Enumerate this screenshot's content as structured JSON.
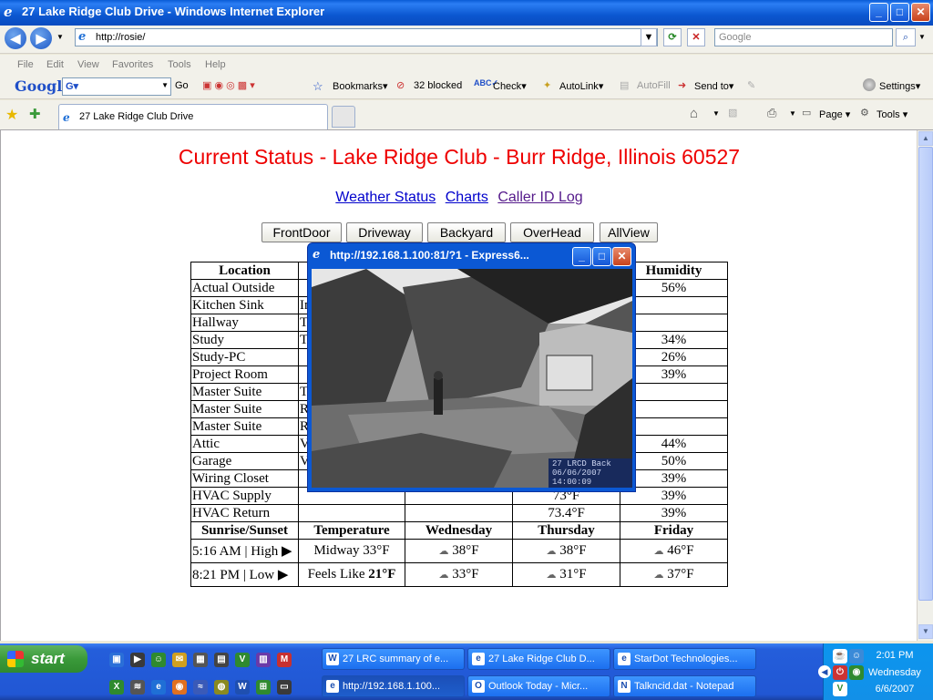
{
  "window": {
    "title": "27 Lake Ridge Club Drive - Windows Internet Explorer",
    "controls": {
      "minimize": "_",
      "maximize": "□",
      "close": "✕"
    }
  },
  "address": {
    "url": "http://rosie/",
    "search_placeholder": "Google"
  },
  "menu": [
    "File",
    "Edit",
    "View",
    "Favorites",
    "Tools",
    "Help"
  ],
  "google_toolbar": {
    "logo": "Google",
    "go": "Go",
    "bookmarks": "Bookmarks",
    "blocked": "32 blocked",
    "check": "Check",
    "autolink": "AutoLink",
    "autofill": "AutoFill",
    "sendto": "Send to",
    "settings": "Settings"
  },
  "tabs": {
    "active_label": "27 Lake Ridge Club Drive",
    "page": "Page",
    "tools": "Tools"
  },
  "page": {
    "title": "Current Status - Lake Ridge Club - Burr Ridge, Illinois 60527",
    "links": [
      "Weather Status",
      "Charts",
      "Caller ID Log"
    ],
    "camera_buttons": [
      "FrontDoor",
      "Driveway",
      "Backyard",
      "OverHead",
      "AllView"
    ],
    "table": {
      "header": {
        "location": "Location",
        "humidity": "Humidity"
      },
      "rows": [
        {
          "loc": "Actual Outside",
          "c2": "",
          "c4": "",
          "hum": "56%"
        },
        {
          "loc": "Kitchen Sink",
          "c2": "In",
          "c4": "",
          "hum": ""
        },
        {
          "loc": "Hallway",
          "c2": "T",
          "c4": "",
          "hum": ""
        },
        {
          "loc": "Study",
          "c2": "T",
          "c4": "",
          "hum": "34%"
        },
        {
          "loc": "Study-PC",
          "c2": "",
          "c4": "",
          "hum": "26%"
        },
        {
          "loc": "Project Room",
          "c2": "",
          "c4": "",
          "hum": "39%"
        },
        {
          "loc": "Master Suite",
          "c2": "T",
          "c4": "",
          "hum": ""
        },
        {
          "loc": "Master Suite",
          "c2": "R",
          "c4": "",
          "hum": ""
        },
        {
          "loc": "Master Suite",
          "c2": "R",
          "c4": "",
          "hum": ""
        },
        {
          "loc": "Attic",
          "c2": "V",
          "c4": "",
          "hum": "44%"
        },
        {
          "loc": "Garage",
          "c2": "V",
          "c4": "",
          "hum": "50%"
        },
        {
          "loc": "Wiring Closet",
          "c2": "",
          "c4": "74.2°F",
          "hum": "39%"
        },
        {
          "loc": "HVAC Supply",
          "c2": "",
          "c4": "73°F",
          "hum": "39%"
        },
        {
          "loc": "HVAC Return",
          "c2": "",
          "c4": "73.4°F",
          "hum": "39%"
        }
      ],
      "forecast_header": [
        "Sunrise/Sunset",
        "Temperature",
        "Wednesday",
        "Thursday",
        "Friday"
      ],
      "forecast_rows": [
        {
          "sun": "5:16 AM | High ▶",
          "temp_prefix": "Midway 33°F",
          "temp_bold": "",
          "wed": "38°F",
          "thu": "38°F",
          "fri": "46°F"
        },
        {
          "sun": "8:21 PM | Low ▶",
          "temp_prefix": "Feels Like ",
          "temp_bold": "21°F",
          "wed": "33°F",
          "thu": "31°F",
          "fri": "37°F"
        }
      ]
    }
  },
  "popup": {
    "title": "http://192.168.1.100:81/?1 - Express6...",
    "stamp_line1": "27 LRCD Back",
    "stamp_line2": "06/06/2007",
    "stamp_line3": "14:00:09"
  },
  "taskbar": {
    "start": "start",
    "buttons": [
      {
        "label": "27 LRC summary of e...",
        "icon": "W"
      },
      {
        "label": "27 Lake Ridge Club D...",
        "icon": "e"
      },
      {
        "label": "StarDot Technologies...",
        "icon": "e"
      },
      {
        "label": "http://192.168.1.100...",
        "icon": "e"
      },
      {
        "label": "Outlook Today - Micr...",
        "icon": "O"
      },
      {
        "label": "Talkncid.dat - Notepad",
        "icon": "N"
      }
    ],
    "clock": {
      "time": "2:01 PM",
      "day": "Wednesday",
      "date": "6/6/2007"
    }
  }
}
